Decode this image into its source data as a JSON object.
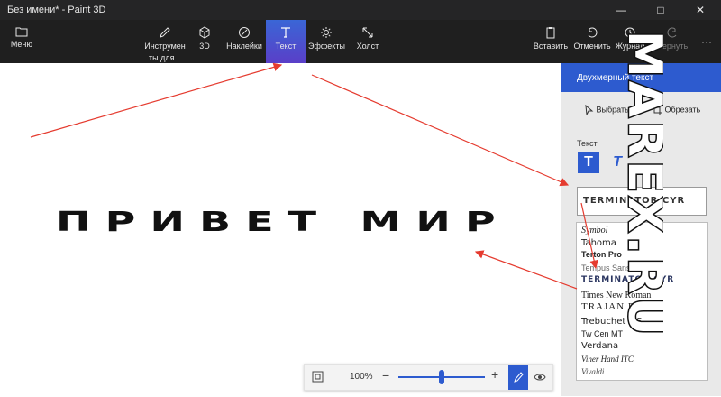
{
  "window": {
    "title": "Без имени* - Paint 3D"
  },
  "toolbar": {
    "menu": "Меню",
    "tools_line1": "Инструмен",
    "tools_line2": "ты для...",
    "d3": "3D",
    "stickers": "Наклейки",
    "text": "Текст",
    "effects": "Эффекты",
    "canvas": "Холст",
    "paste": "Вставить",
    "undo": "Отменить",
    "history": "Журнал",
    "redo": "Вернуть",
    "more": "···"
  },
  "canvas": {
    "text": "ПРИВЕТ МИР"
  },
  "zoom": {
    "value": "100%",
    "level_fraction": 0.5
  },
  "panel": {
    "title": "Двухмерный текст",
    "select": "Выбрать",
    "crop": "Обрезать",
    "section_text": "Текст",
    "current_font_preview": "TERMINATOR CYR",
    "fonts": [
      "Symbol",
      "Tahoma",
      "Terton Pro",
      "Tempus Sans ITC",
      "TERMINATOR CYR",
      "Times New Roman",
      "TRAJAN PRO 3",
      "Trebuchet MS",
      "Tw Cen MT",
      "Verdana",
      "Viner Hand ITC",
      "Vivaldi"
    ]
  },
  "watermark": {
    "text": "MAREX.RU"
  },
  "colors": {
    "accent": "#2d5bcf",
    "arrow": "#e53b2f"
  }
}
